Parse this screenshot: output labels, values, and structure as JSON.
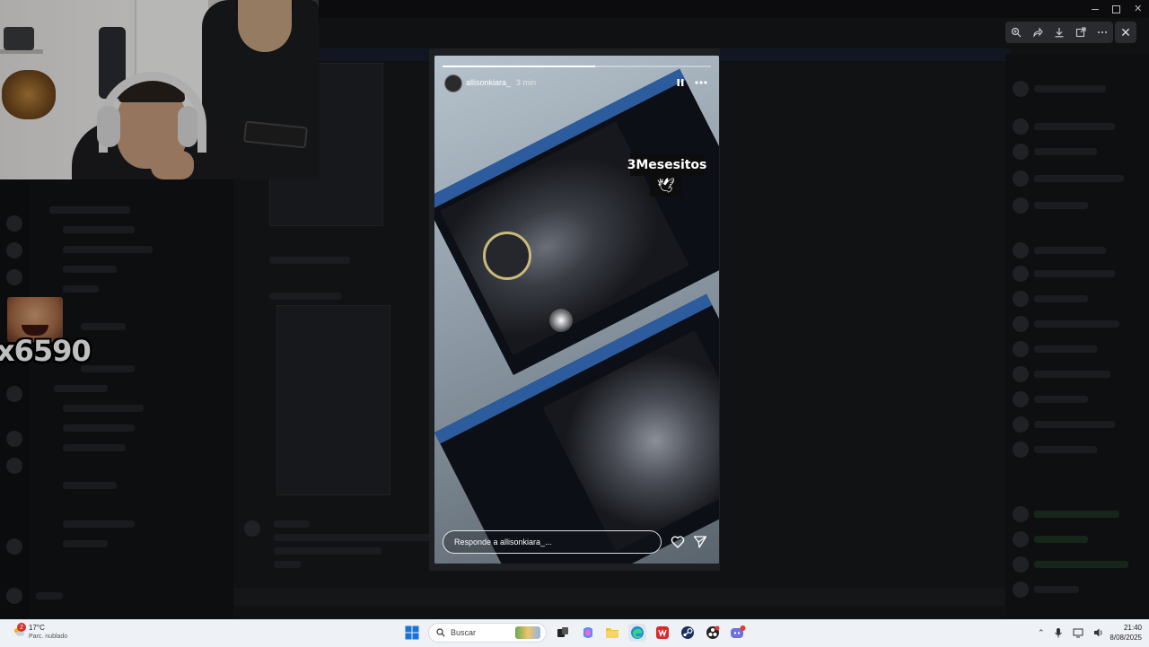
{
  "story": {
    "username": "allisonkiara_",
    "time_ago": "3 min",
    "sticker_text": "3Mesesitos",
    "sticker_emoji": "🕊",
    "reply_placeholder": "Responde a allisonkiara_...",
    "progress_fraction": 0.57
  },
  "overlay": {
    "counter_text": "x6590"
  },
  "viewer": {
    "icons": [
      "zoom-in-icon",
      "share-icon",
      "download-icon",
      "open-external-icon",
      "more-icon"
    ],
    "close_icon": "close-icon"
  },
  "taskbar": {
    "weather_temp": "17°C",
    "weather_desc": "Parc. nublado",
    "weather_badge": "2",
    "search_placeholder": "Buscar",
    "time": "21:40",
    "date": "8/08/2025"
  },
  "colors": {
    "taskbar_bg": "#eef1f6",
    "accent_blue": "#2c5b9e"
  }
}
